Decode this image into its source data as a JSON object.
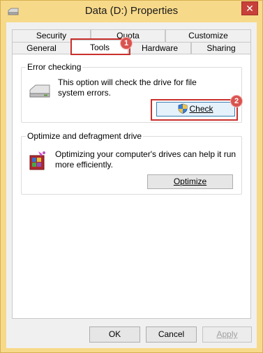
{
  "window": {
    "title": "Data (D:) Properties",
    "close_glyph": "✕",
    "titlebar_color": "#f7d98a"
  },
  "tabs": {
    "row1": [
      "Security",
      "Quota",
      "Customize"
    ],
    "row2": [
      "General",
      "Tools",
      "Hardware",
      "Sharing"
    ],
    "selected": "Tools"
  },
  "error_checking": {
    "heading": "Error checking",
    "line1": "This option will check the drive for file",
    "line2": "system errors.",
    "button_label": "Check"
  },
  "optimize": {
    "heading": "Optimize and defragment drive",
    "line1": "Optimizing your computer's drives can help it run",
    "line2": "more efficiently.",
    "button_label": "Optimize"
  },
  "footer": {
    "ok": "OK",
    "cancel": "Cancel",
    "apply": "Apply"
  },
  "annotations": {
    "badge1": "1",
    "badge2": "2",
    "color": "#c9302c"
  }
}
